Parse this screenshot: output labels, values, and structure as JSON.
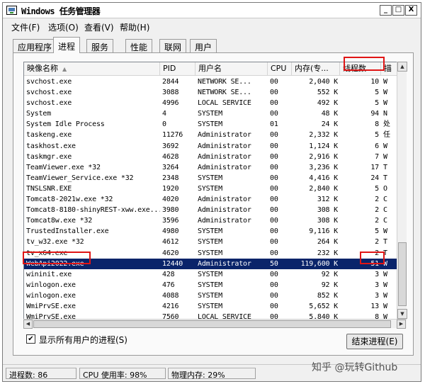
{
  "window": {
    "title": "Windows 任务管理器",
    "controls": {
      "minimize": "_",
      "maximize": "□",
      "close": "X"
    }
  },
  "menu": [
    "文件(F)",
    "选项(O)",
    "查看(V)",
    "帮助(H)"
  ],
  "tabs": [
    "应用程序",
    "进程",
    "服务",
    "性能",
    "联网",
    "用户"
  ],
  "active_tab": "进程",
  "columns": [
    "映像名称",
    "PID",
    "用户名",
    "CPU",
    "内存(专...",
    "线程数",
    "描"
  ],
  "sort_indicator": "▲",
  "processes": [
    {
      "name": "svchost.exe",
      "pid": "2844",
      "user": "NETWORK SE...",
      "cpu": "00",
      "mem": "2,040 K",
      "threads": "10",
      "desc": "W"
    },
    {
      "name": "svchost.exe",
      "pid": "3088",
      "user": "NETWORK SE...",
      "cpu": "00",
      "mem": "552 K",
      "threads": "5",
      "desc": "W"
    },
    {
      "name": "svchost.exe",
      "pid": "4996",
      "user": "LOCAL SERVICE",
      "cpu": "00",
      "mem": "492 K",
      "threads": "5",
      "desc": "W"
    },
    {
      "name": "System",
      "pid": "4",
      "user": "SYSTEM",
      "cpu": "00",
      "mem": "48 K",
      "threads": "94",
      "desc": "N"
    },
    {
      "name": "System Idle Process",
      "pid": "0",
      "user": "SYSTEM",
      "cpu": "01",
      "mem": "24 K",
      "threads": "8",
      "desc": "处"
    },
    {
      "name": "taskeng.exe",
      "pid": "11276",
      "user": "Administrator",
      "cpu": "00",
      "mem": "2,332 K",
      "threads": "5",
      "desc": "任"
    },
    {
      "name": "taskhost.exe",
      "pid": "3692",
      "user": "Administrator",
      "cpu": "00",
      "mem": "1,124 K",
      "threads": "6",
      "desc": "W"
    },
    {
      "name": "taskmgr.exe",
      "pid": "4628",
      "user": "Administrator",
      "cpu": "00",
      "mem": "2,916 K",
      "threads": "7",
      "desc": "W"
    },
    {
      "name": "TeamViewer.exe *32",
      "pid": "3264",
      "user": "Administrator",
      "cpu": "00",
      "mem": "3,236 K",
      "threads": "17",
      "desc": "T"
    },
    {
      "name": "TeamViewer_Service.exe *32",
      "pid": "2348",
      "user": "SYSTEM",
      "cpu": "00",
      "mem": "4,416 K",
      "threads": "24",
      "desc": "T"
    },
    {
      "name": "TNSLSNR.EXE",
      "pid": "1920",
      "user": "SYSTEM",
      "cpu": "00",
      "mem": "2,840 K",
      "threads": "5",
      "desc": "O"
    },
    {
      "name": "Tomcat8-2021w.exe *32",
      "pid": "4020",
      "user": "Administrator",
      "cpu": "00",
      "mem": "312 K",
      "threads": "2",
      "desc": "C"
    },
    {
      "name": "Tomcat8-8180-shinyREST-xww.exe...",
      "pid": "3980",
      "user": "Administrator",
      "cpu": "00",
      "mem": "308 K",
      "threads": "2",
      "desc": "C"
    },
    {
      "name": "Tomcat8w.exe *32",
      "pid": "3596",
      "user": "Administrator",
      "cpu": "00",
      "mem": "308 K",
      "threads": "2",
      "desc": "C"
    },
    {
      "name": "TrustedInstaller.exe",
      "pid": "4980",
      "user": "SYSTEM",
      "cpu": "00",
      "mem": "9,116 K",
      "threads": "5",
      "desc": "W"
    },
    {
      "name": "tv_w32.exe *32",
      "pid": "4612",
      "user": "SYSTEM",
      "cpu": "00",
      "mem": "264 K",
      "threads": "2",
      "desc": "T"
    },
    {
      "name": "tv_x64.exe",
      "pid": "4620",
      "user": "SYSTEM",
      "cpu": "00",
      "mem": "232 K",
      "threads": "2",
      "desc": "T"
    },
    {
      "name": "WebApi2022.exe",
      "pid": "12440",
      "user": "Administrator",
      "cpu": "50",
      "mem": "119,600 K",
      "threads": "51",
      "desc": "W",
      "selected": true
    },
    {
      "name": "wininit.exe",
      "pid": "428",
      "user": "SYSTEM",
      "cpu": "00",
      "mem": "92 K",
      "threads": "3",
      "desc": "W"
    },
    {
      "name": "winlogon.exe",
      "pid": "476",
      "user": "SYSTEM",
      "cpu": "00",
      "mem": "92 K",
      "threads": "3",
      "desc": "W"
    },
    {
      "name": "winlogon.exe",
      "pid": "4088",
      "user": "SYSTEM",
      "cpu": "00",
      "mem": "852 K",
      "threads": "3",
      "desc": "W"
    },
    {
      "name": "WmiPrvSE.exe",
      "pid": "4216",
      "user": "SYSTEM",
      "cpu": "00",
      "mem": "5,652 K",
      "threads": "13",
      "desc": "W"
    },
    {
      "name": "WmiPrvSE.exe",
      "pid": "7560",
      "user": "LOCAL SERVICE",
      "cpu": "00",
      "mem": "5,840 K",
      "threads": "8",
      "desc": "W"
    }
  ],
  "show_all_users": {
    "label": "显示所有用户的进程(S)",
    "checked": "✔"
  },
  "end_process_label": "结束进程(E)",
  "status": {
    "processes": "进程数: 86",
    "cpu": "CPU 使用率: 98%",
    "memory": "物理内存: 29%"
  },
  "watermark": "知乎 @玩转Github",
  "colors": {
    "selection": "#0a246a",
    "highlight_box": "#e01515"
  }
}
